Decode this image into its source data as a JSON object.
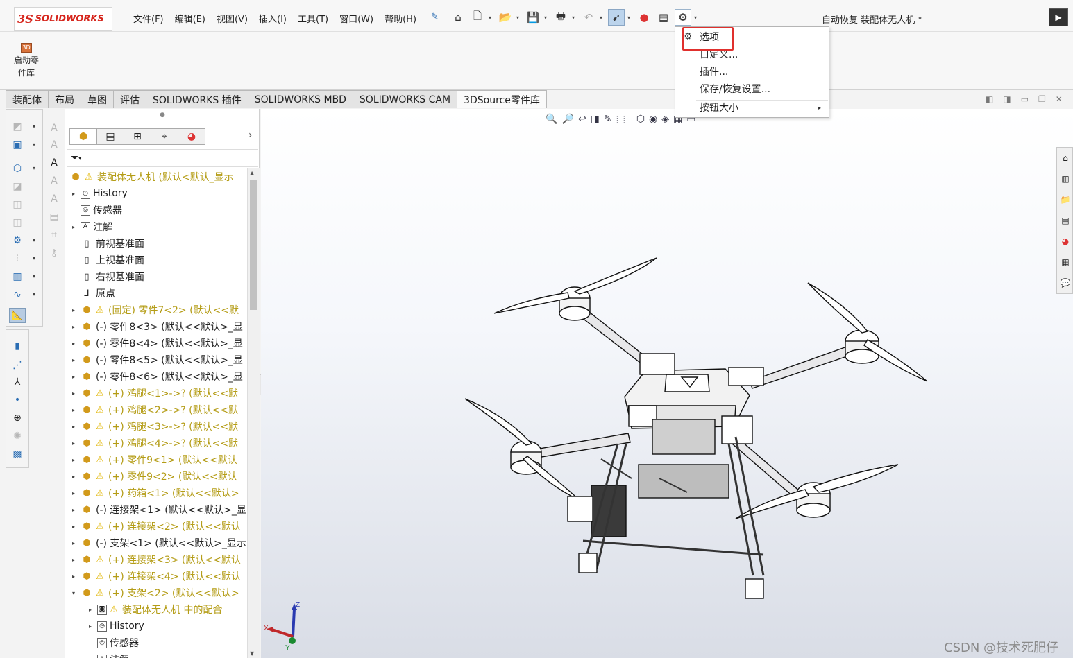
{
  "app": {
    "brand": "SOLIDWORKS",
    "brand_mark": "3S",
    "document_title": "自动恢复 装配体无人机 *"
  },
  "menus": [
    "文件(F)",
    "编辑(E)",
    "视图(V)",
    "插入(I)",
    "工具(T)",
    "窗口(W)",
    "帮助(H)"
  ],
  "ribbon": {
    "button_label_line1": "启动零",
    "button_label_line2": "件库",
    "button_icon_text": "3D"
  },
  "tabs": [
    "装配体",
    "布局",
    "草图",
    "评估",
    "SOLIDWORKS 插件",
    "SOLIDWORKS MBD",
    "SOLIDWORKS CAM",
    "3DSource零件库"
  ],
  "active_tab": "3DSource零件库",
  "options_menu": {
    "items": [
      {
        "label": "选项",
        "highlighted": true
      },
      {
        "label": "自定义..."
      },
      {
        "label": "插件..."
      },
      {
        "label": "保存/恢复设置..."
      },
      {
        "label": "按钮大小",
        "submenu": true
      }
    ]
  },
  "tree": {
    "root": "装配体无人机 (默认<默认_显示",
    "rows": [
      {
        "label": "History",
        "warn": false,
        "exp": "right",
        "indent": 1,
        "icon": "history-icon",
        "yellow": false
      },
      {
        "label": "传感器",
        "warn": false,
        "exp": "",
        "indent": 1,
        "icon": "sensor-icon",
        "yellow": false
      },
      {
        "label": "注解",
        "warn": false,
        "exp": "right",
        "indent": 1,
        "icon": "annotation-icon",
        "yellow": false
      },
      {
        "label": "前视基准面",
        "warn": false,
        "exp": "",
        "indent": 1,
        "icon": "plane-icon",
        "yellow": false
      },
      {
        "label": "上视基准面",
        "warn": false,
        "exp": "",
        "indent": 1,
        "icon": "plane-icon",
        "yellow": false
      },
      {
        "label": "右视基准面",
        "warn": false,
        "exp": "",
        "indent": 1,
        "icon": "plane-icon",
        "yellow": false
      },
      {
        "label": "原点",
        "warn": false,
        "exp": "",
        "indent": 1,
        "icon": "origin-icon",
        "yellow": false
      },
      {
        "label": "(固定) 零件7<2> (默认<<默",
        "warn": true,
        "exp": "right",
        "indent": 1,
        "icon": "part-icon",
        "yellow": true
      },
      {
        "label": "(-) 零件8<3> (默认<<默认>_显",
        "warn": false,
        "exp": "right",
        "indent": 1,
        "icon": "part-icon",
        "yellow": false
      },
      {
        "label": "(-) 零件8<4> (默认<<默认>_显",
        "warn": false,
        "exp": "right",
        "indent": 1,
        "icon": "part-icon",
        "yellow": false
      },
      {
        "label": "(-) 零件8<5> (默认<<默认>_显",
        "warn": false,
        "exp": "right",
        "indent": 1,
        "icon": "part-icon",
        "yellow": false
      },
      {
        "label": "(-) 零件8<6> (默认<<默认>_显",
        "warn": false,
        "exp": "right",
        "indent": 1,
        "icon": "part-icon",
        "yellow": false
      },
      {
        "label": "(+) 鸡腿<1>->? (默认<<默",
        "warn": true,
        "exp": "right",
        "indent": 1,
        "icon": "part-icon",
        "yellow": true
      },
      {
        "label": "(+) 鸡腿<2>->? (默认<<默",
        "warn": true,
        "exp": "right",
        "indent": 1,
        "icon": "part-icon",
        "yellow": true
      },
      {
        "label": "(+) 鸡腿<3>->? (默认<<默",
        "warn": true,
        "exp": "right",
        "indent": 1,
        "icon": "part-icon",
        "yellow": true
      },
      {
        "label": "(+) 鸡腿<4>->? (默认<<默",
        "warn": true,
        "exp": "right",
        "indent": 1,
        "icon": "part-icon",
        "yellow": true
      },
      {
        "label": "(+) 零件9<1> (默认<<默认",
        "warn": true,
        "exp": "right",
        "indent": 1,
        "icon": "part-icon",
        "yellow": true
      },
      {
        "label": "(+) 零件9<2> (默认<<默认",
        "warn": true,
        "exp": "right",
        "indent": 1,
        "icon": "part-icon",
        "yellow": true
      },
      {
        "label": "(+) 药箱<1> (默认<<默认>",
        "warn": true,
        "exp": "right",
        "indent": 1,
        "icon": "part-icon",
        "yellow": true
      },
      {
        "label": "(-) 连接架<1> (默认<<默认>_显",
        "warn": false,
        "exp": "right",
        "indent": 1,
        "icon": "part-icon",
        "yellow": false
      },
      {
        "label": "(+) 连接架<2> (默认<<默认",
        "warn": true,
        "exp": "right",
        "indent": 1,
        "icon": "part-icon",
        "yellow": true
      },
      {
        "label": "(-) 支架<1> (默认<<默认>_显示",
        "warn": false,
        "exp": "right",
        "indent": 1,
        "icon": "part-icon",
        "yellow": false
      },
      {
        "label": "(+) 连接架<3> (默认<<默认",
        "warn": true,
        "exp": "right",
        "indent": 1,
        "icon": "part-icon",
        "yellow": true
      },
      {
        "label": "(+) 连接架<4> (默认<<默认",
        "warn": true,
        "exp": "right",
        "indent": 1,
        "icon": "part-icon",
        "yellow": true
      },
      {
        "label": "(+) 支架<2> (默认<<默认>",
        "warn": true,
        "exp": "down",
        "indent": 1,
        "icon": "part-icon",
        "yellow": true
      },
      {
        "label": "装配体无人机 中的配合",
        "warn": true,
        "exp": "right",
        "indent": 2,
        "icon": "mates-icon",
        "yellow": true
      },
      {
        "label": "History",
        "warn": false,
        "exp": "right",
        "indent": 2,
        "icon": "history-icon",
        "yellow": false
      },
      {
        "label": "传感器",
        "warn": false,
        "exp": "",
        "indent": 2,
        "icon": "sensor-icon",
        "yellow": false
      },
      {
        "label": "注解",
        "warn": false,
        "exp": "right",
        "indent": 2,
        "icon": "annotation-icon",
        "yellow": false
      }
    ]
  },
  "triad": {
    "x": "X",
    "y": "Y",
    "z": "Z"
  },
  "watermark": "CSDN @技术死肥仔",
  "colors": {
    "highlight_box": "#e0302d",
    "warning": "#e2b600",
    "tree_warning_text": "#b49c15",
    "brand": "#d6261d"
  }
}
